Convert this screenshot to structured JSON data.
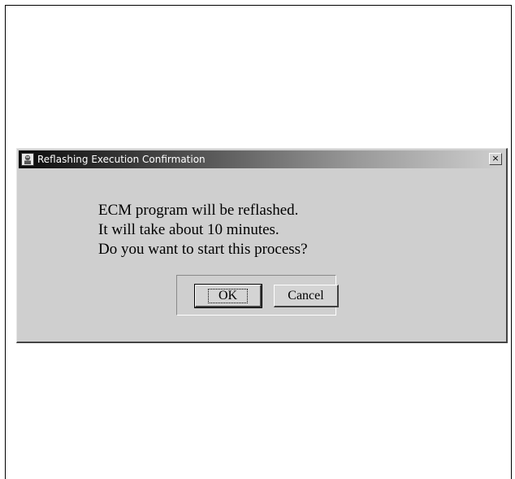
{
  "dialog": {
    "title": "Reflashing Execution Confirmation",
    "title_icon": "app-icon",
    "close_label": "×",
    "message_lines": [
      "ECM program will be reflashed.",
      "It will take about 10 minutes.",
      "Do you want to start this process?"
    ],
    "ok_label": "OK",
    "cancel_label": "Cancel"
  }
}
